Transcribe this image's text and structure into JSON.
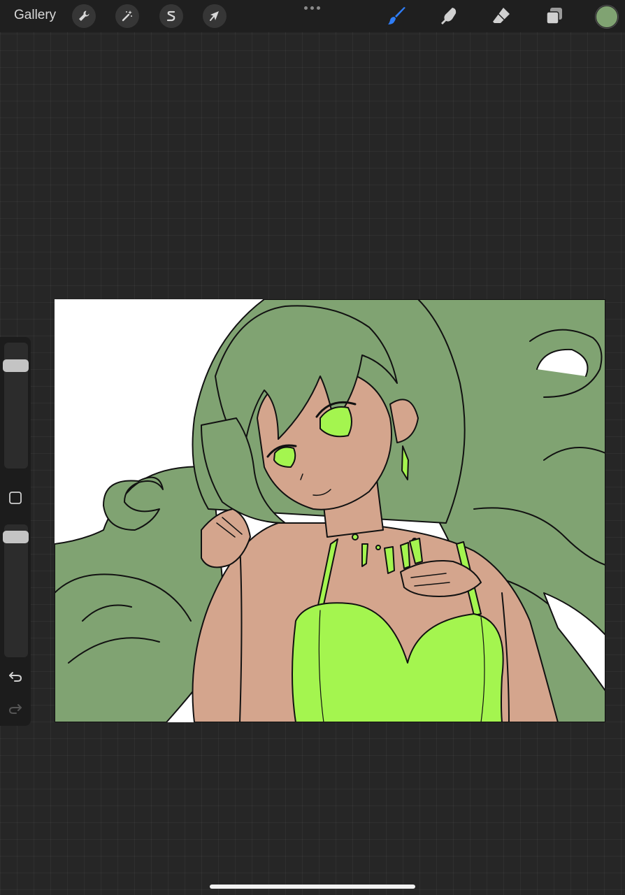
{
  "toolbar": {
    "gallery_label": "Gallery",
    "left_tools": [
      {
        "name": "actions",
        "icon": "wrench-icon"
      },
      {
        "name": "adjustments",
        "icon": "magic-wand-icon"
      },
      {
        "name": "selection",
        "icon": "selection-s-icon"
      },
      {
        "name": "transform",
        "icon": "arrow-cursor-icon"
      }
    ],
    "more_icon": "more-dots-icon",
    "right_tools": [
      {
        "name": "brush",
        "icon": "brush-icon",
        "active": true
      },
      {
        "name": "smudge",
        "icon": "smudge-finger-icon",
        "active": false
      },
      {
        "name": "eraser",
        "icon": "eraser-icon",
        "active": false
      },
      {
        "name": "layers",
        "icon": "layers-icon",
        "active": false
      }
    ],
    "current_color": "#80a372",
    "active_tool_color": "#2f7df6"
  },
  "sidebar": {
    "brush_size_level": 0.85,
    "opacity_level": 0.95,
    "modify_icon": "modify-square-icon",
    "undo_icon": "undo-icon",
    "redo_icon": "redo-icon"
  },
  "artwork": {
    "hair_color": "#80a372",
    "skin_color": "#d4a58d",
    "accent_color": "#a4f54f",
    "line_color": "#111111",
    "background": "#ffffff"
  }
}
